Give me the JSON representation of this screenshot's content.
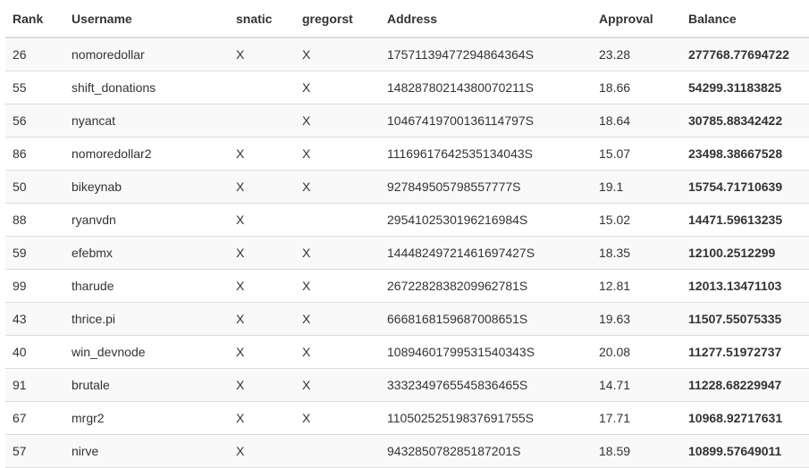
{
  "table": {
    "headers": {
      "rank": "Rank",
      "username": "Username",
      "snatic": "snatic",
      "gregorst": "gregorst",
      "address": "Address",
      "approval": "Approval",
      "balance": "Balance"
    },
    "rows": [
      {
        "rank": "26",
        "username": "nomoredollar",
        "snatic": "X",
        "gregorst": "X",
        "address": "17571139477294864364S",
        "approval": "23.28",
        "balance": "277768.77694722"
      },
      {
        "rank": "55",
        "username": "shift_donations",
        "snatic": "",
        "gregorst": "X",
        "address": "14828780214380070211S",
        "approval": "18.66",
        "balance": "54299.31183825"
      },
      {
        "rank": "56",
        "username": "nyancat",
        "snatic": "",
        "gregorst": "X",
        "address": "10467419700136114797S",
        "approval": "18.64",
        "balance": "30785.88342422"
      },
      {
        "rank": "86",
        "username": "nomoredollar2",
        "snatic": "X",
        "gregorst": "X",
        "address": "11169617642535134043S",
        "approval": "15.07",
        "balance": "23498.38667528"
      },
      {
        "rank": "50",
        "username": "bikeynab",
        "snatic": "X",
        "gregorst": "X",
        "address": "927849505798557777S",
        "approval": "19.1",
        "balance": "15754.71710639"
      },
      {
        "rank": "88",
        "username": "ryanvdn",
        "snatic": "X",
        "gregorst": "",
        "address": "2954102530196216984S",
        "approval": "15.02",
        "balance": "14471.59613235"
      },
      {
        "rank": "59",
        "username": "efebmx",
        "snatic": "X",
        "gregorst": "X",
        "address": "14448249721461697427S",
        "approval": "18.35",
        "balance": "12100.2512299"
      },
      {
        "rank": "99",
        "username": "tharude",
        "snatic": "X",
        "gregorst": "X",
        "address": "2672282838209962781S",
        "approval": "12.81",
        "balance": "12013.13471103"
      },
      {
        "rank": "43",
        "username": "thrice.pi",
        "snatic": "X",
        "gregorst": "X",
        "address": "6668168159687008651S",
        "approval": "19.63",
        "balance": "11507.55075335"
      },
      {
        "rank": "40",
        "username": "win_devnode",
        "snatic": "X",
        "gregorst": "X",
        "address": "10894601799531540343S",
        "approval": "20.08",
        "balance": "11277.51972737"
      },
      {
        "rank": "91",
        "username": "brutale",
        "snatic": "X",
        "gregorst": "X",
        "address": "3332349765545836465S",
        "approval": "14.71",
        "balance": "11228.68229947"
      },
      {
        "rank": "67",
        "username": "mrgr2",
        "snatic": "X",
        "gregorst": "X",
        "address": "11050252519837691755S",
        "approval": "17.71",
        "balance": "10968.92717631"
      },
      {
        "rank": "57",
        "username": "nirve",
        "snatic": "X",
        "gregorst": "",
        "address": "943285078285187201S",
        "approval": "18.59",
        "balance": "10899.57649011"
      }
    ]
  }
}
